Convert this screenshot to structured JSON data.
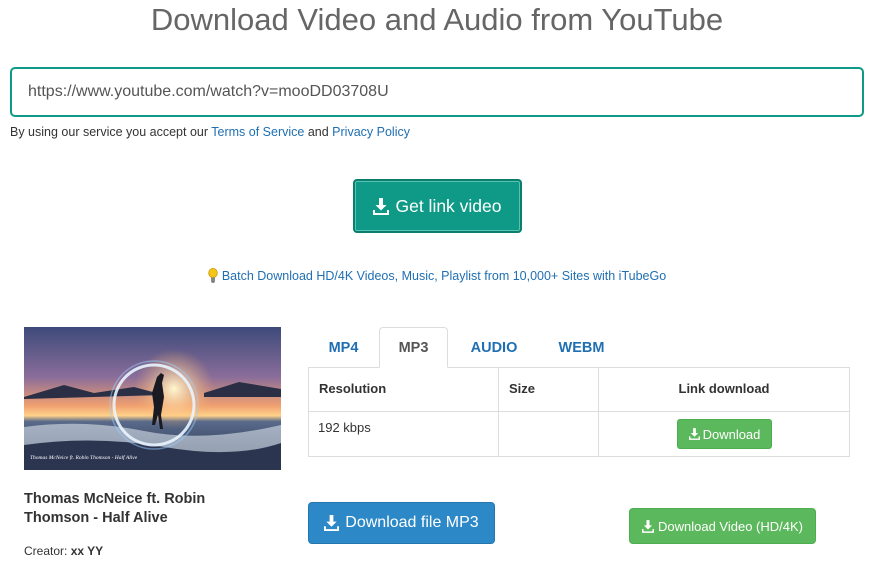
{
  "header": {
    "title": "Download Video and Audio from YouTube"
  },
  "search": {
    "value": "https://www.youtube.com/watch?v=mooDD03708U"
  },
  "terms": {
    "prefix": "By using our service you accept our ",
    "tos_label": "Terms of Service",
    "and": " and ",
    "privacy_label": "Privacy Policy"
  },
  "get_link": {
    "label": "Get link video",
    "icon": "download-icon"
  },
  "batch": {
    "label": "Batch Download HD/4K Videos, Music, Playlist from 10,000+ Sites with iTubeGo",
    "icon": "lightbulb-icon"
  },
  "video": {
    "title": "Thomas McNeice ft. Robin Thomson - Half Alive",
    "creator_label": "Creator: ",
    "creator_name": "xx YY",
    "thumb_caption": "Thomas McNeice ft. Robin Thomson - Half Alive"
  },
  "tabs": [
    {
      "label": "MP4",
      "active": false
    },
    {
      "label": "MP3",
      "active": true
    },
    {
      "label": "AUDIO",
      "active": false
    },
    {
      "label": "WEBM",
      "active": false
    }
  ],
  "table": {
    "headers": [
      "Resolution",
      "Size",
      "Link download"
    ],
    "rows": [
      {
        "resolution": "192 kbps",
        "size": "",
        "link_label": "Download"
      }
    ]
  },
  "buttons": {
    "download_mp3": "Download file MP3",
    "download_video": "Download Video (HD/4K)"
  },
  "colors": {
    "accent": "#0e9a86",
    "link": "#1f6fb2",
    "success": "#5cb85c",
    "primary": "#2c88c7"
  }
}
